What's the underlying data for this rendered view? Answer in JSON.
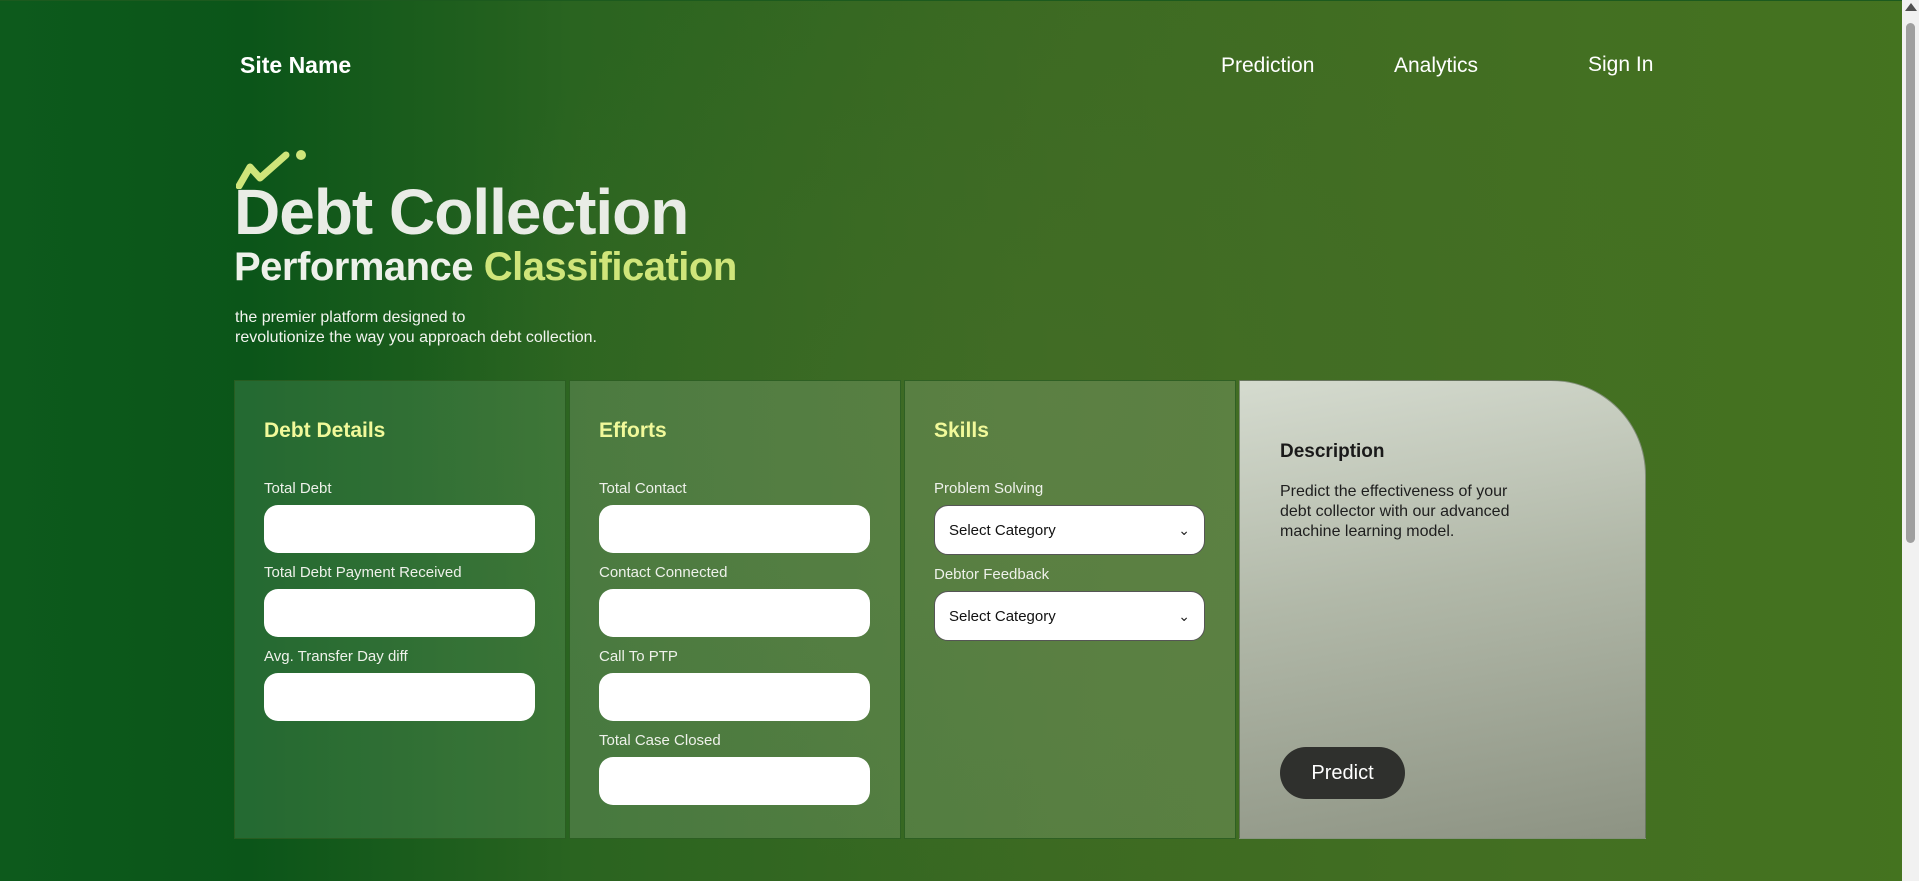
{
  "nav": {
    "site_name": "Site Name",
    "links": [
      "Prediction",
      "Analytics",
      "Sign In"
    ]
  },
  "hero": {
    "title": "Debt Collection",
    "subtitle_main": "Performance",
    "subtitle_accent": "Classification",
    "tagline_line1": "the premier platform designed to",
    "tagline_line2": "revolutionize the way you approach debt collection."
  },
  "panels": {
    "debt_details": {
      "title": "Debt Details",
      "fields": [
        "Total Debt",
        "Total Debt Payment Received",
        "Avg. Transfer Day diff"
      ]
    },
    "efforts": {
      "title": "Efforts",
      "fields": [
        "Total Contact",
        "Contact Connected",
        "Call To PTP",
        "Total Case Closed"
      ]
    },
    "skills": {
      "title": "Skills",
      "fields": [
        {
          "label": "Problem Solving",
          "selected": "Select Category"
        },
        {
          "label": "Debtor Feedback",
          "selected": "Select Category"
        }
      ]
    },
    "description": {
      "title": "Description",
      "text": "Predict the effectiveness of your debt collector with our advanced machine learning model.",
      "button": "Predict"
    }
  },
  "colors": {
    "accent": "#cfe57a",
    "panel_title": "#f1f99a",
    "button": "#2f302d"
  }
}
